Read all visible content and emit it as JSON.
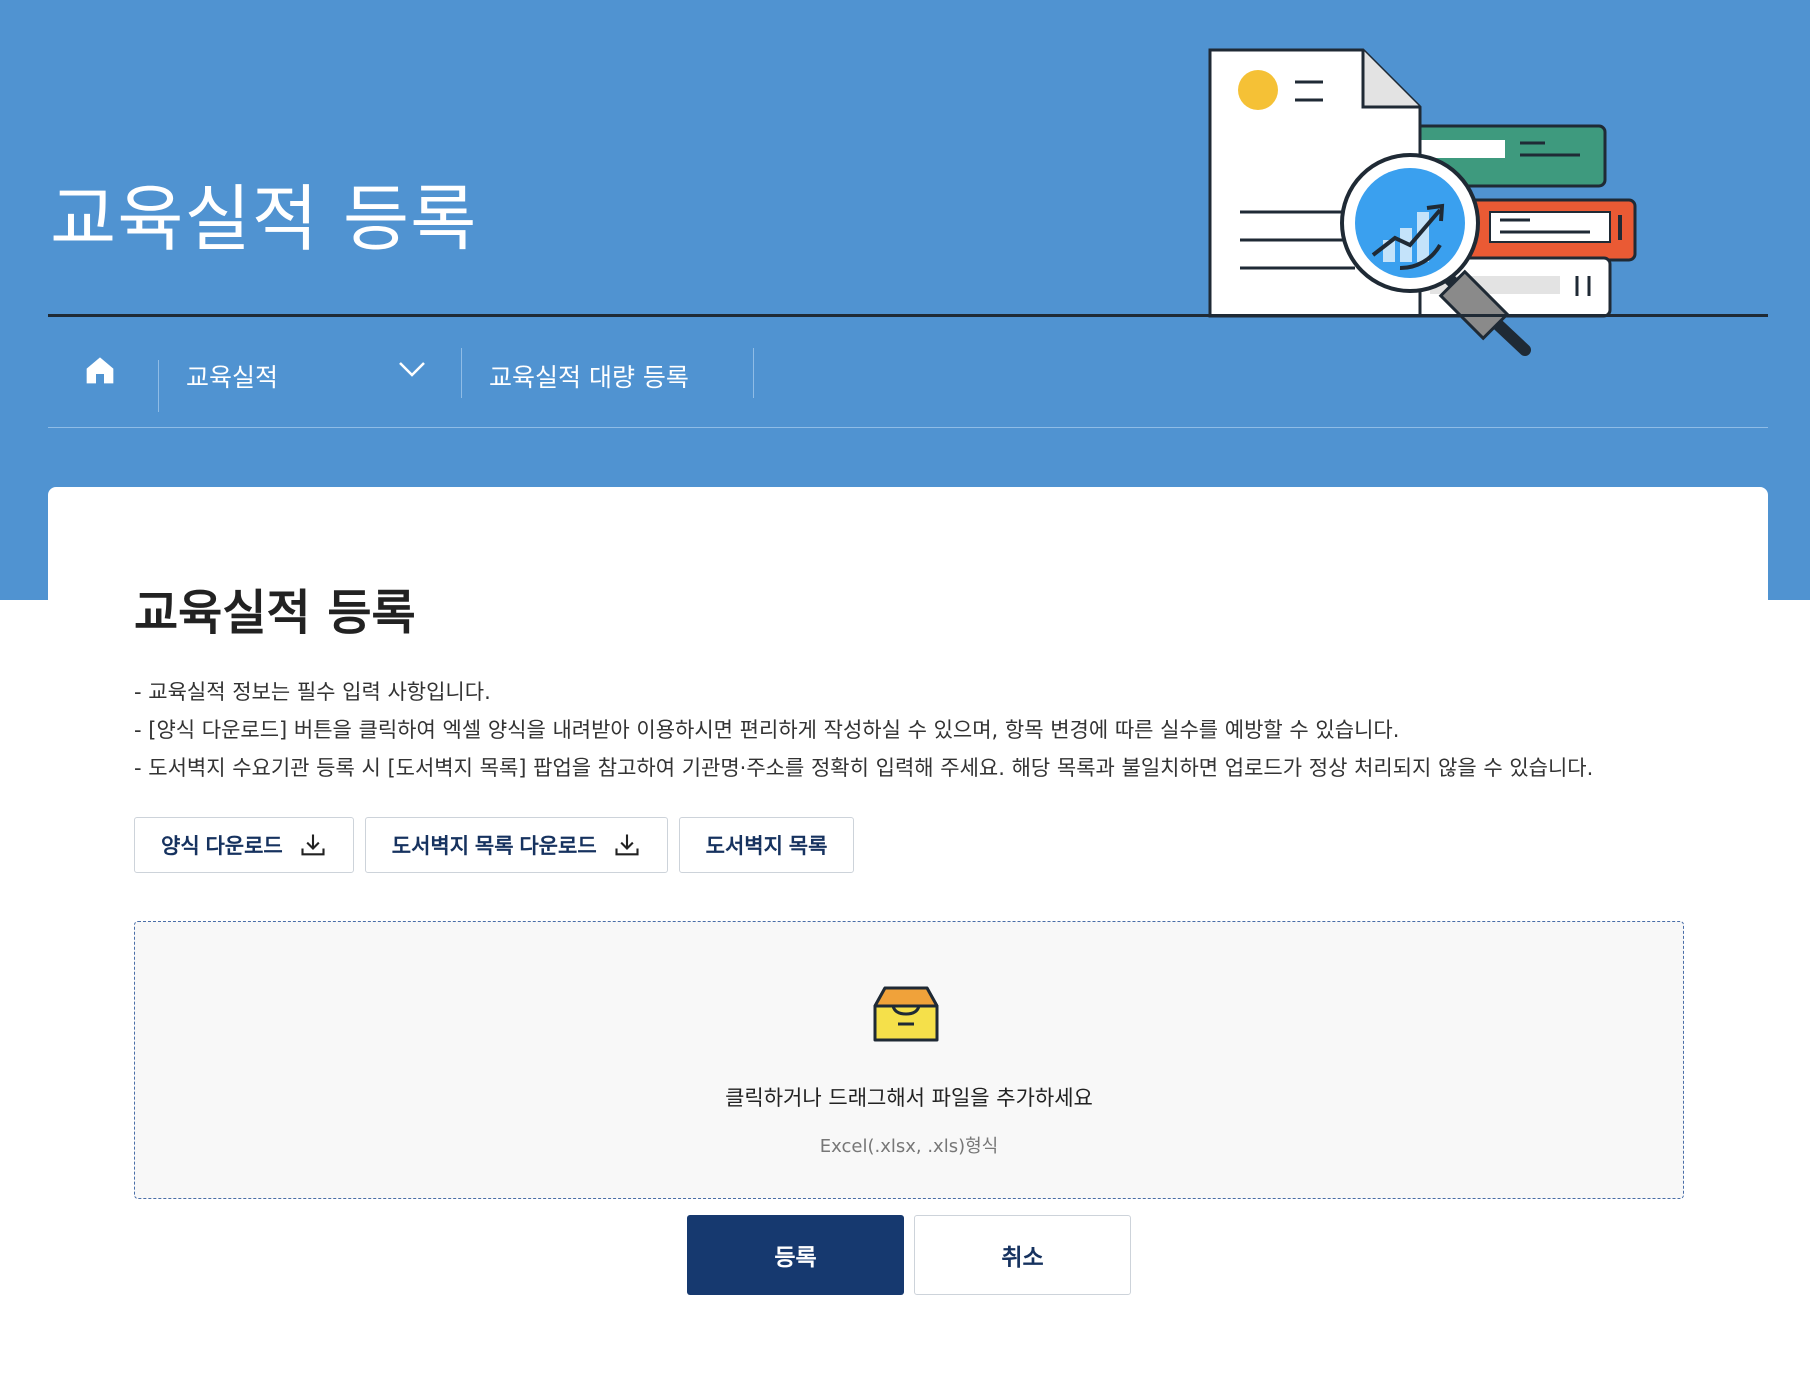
{
  "hero": {
    "title": "교육실적 등록"
  },
  "breadcrumb": {
    "items": [
      {
        "label": "교육실적"
      },
      {
        "label": "교육실적 대량 등록"
      }
    ]
  },
  "main": {
    "title": "교육실적 등록",
    "notes": [
      "- 교육실적 정보는 필수 입력 사항입니다.",
      "- [양식 다운로드] 버튼을 클릭하여 엑셀 양식을 내려받아 이용하시면 편리하게 작성하실 수 있으며, 항목 변경에 따른 실수를 예방할 수 있습니다.",
      "- 도서벽지 수요기관 등록 시 [도서벽지 목록] 팝업을 참고하여 기관명·주소를 정확히 입력해 주세요. 해당 목록과 불일치하면 업로드가 정상 처리되지 않을 수 있습니다."
    ],
    "buttons": {
      "template_download": "양식 다운로드",
      "remote_list_download": "도서벽지 목록 다운로드",
      "remote_list": "도서벽지 목록"
    },
    "dropzone": {
      "title": "클릭하거나 드래그해서 파일을 추가하세요",
      "subtitle": "Excel(.xlsx, .xls)형식"
    },
    "actions": {
      "submit": "등록",
      "cancel": "취소"
    }
  },
  "colors": {
    "hero_bg": "#5093d1",
    "primary": "#16396f",
    "button_text": "#16325f"
  },
  "icons": {
    "home": "home-icon",
    "chevron": "chevron-down-icon",
    "download": "download-icon",
    "dropzone": "inbox-icon"
  }
}
